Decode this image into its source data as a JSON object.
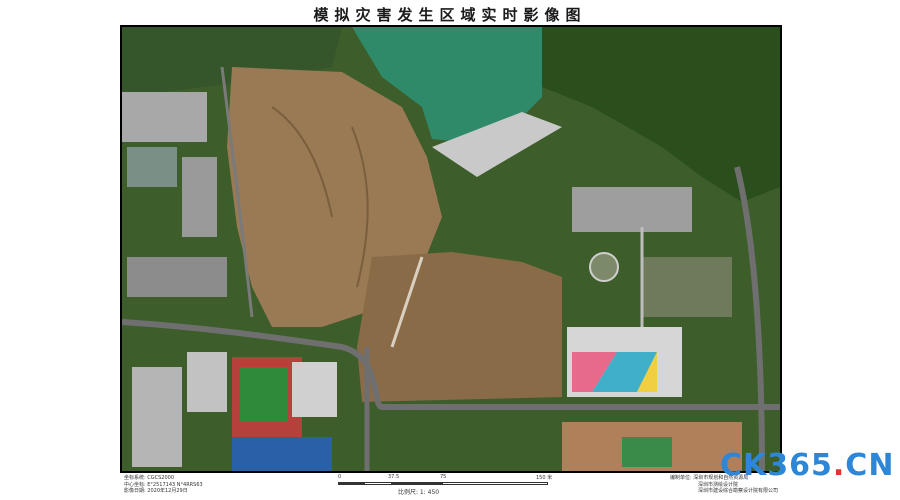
{
  "title": "模拟灾害发生区域实时影像图",
  "metadata_left": {
    "line1": "坐标系统: CGCS2000",
    "line2": "中心坐标: E°2517143   N°4RRS63",
    "line3": "影像日期: 2020年12月29日"
  },
  "scale": {
    "ticks": [
      "0",
      "37.5",
      "75",
      "150 米"
    ],
    "ratio": "比例尺: 1: 450"
  },
  "metadata_right": {
    "line1": "编制单位: 深圳市规划和自然资源局",
    "line2": "深圳市测绘设计院",
    "line3": "深圳市建设综合勘察设计院有限公司"
  },
  "watermark": {
    "part1": "CK365",
    "part2": ".",
    "part3": "CN"
  },
  "colors": {
    "water": "#2f8a6a",
    "forest": "#2f5a1f",
    "bare_soil": "#9a7a55",
    "road": "#6f6f6f",
    "watermark_blue": "#2e86d6",
    "watermark_red": "#e8312f"
  }
}
